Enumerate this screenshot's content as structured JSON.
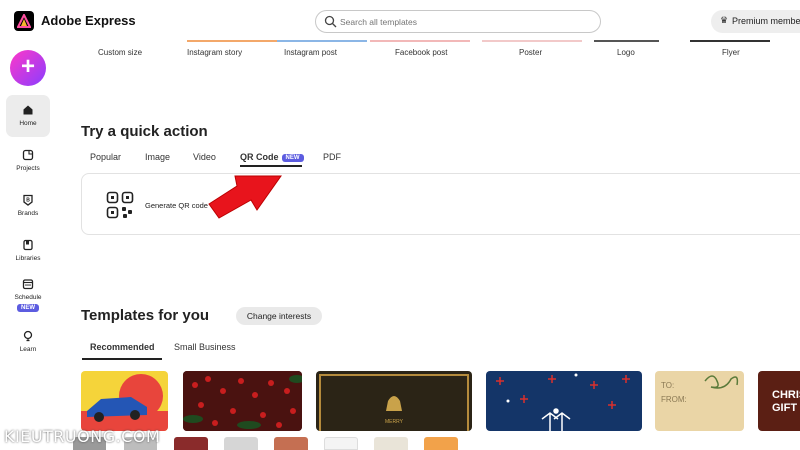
{
  "app": {
    "title": "Adobe Express"
  },
  "search": {
    "placeholder": "Search all templates"
  },
  "premium": {
    "label": "Premium member"
  },
  "sidebar": {
    "create_label": "+",
    "items": [
      {
        "label": "Home"
      },
      {
        "label": "Projects"
      },
      {
        "label": "Brands"
      },
      {
        "label": "Libraries"
      },
      {
        "label": "Schedule",
        "badge": "NEW"
      },
      {
        "label": "Learn"
      }
    ]
  },
  "template_sizes": [
    "Custom size",
    "Instagram story",
    "Instagram post",
    "Facebook post",
    "Poster",
    "Logo",
    "Flyer"
  ],
  "quick_action": {
    "title": "Try a quick action",
    "tabs": [
      "Popular",
      "Image",
      "Video",
      "QR Code",
      "PDF"
    ],
    "active_tab_badge": "NEW",
    "item_label": "Generate QR code"
  },
  "templates": {
    "title": "Templates for you",
    "change_interests": "Change interests",
    "tabs": [
      "Recommended",
      "Small Business"
    ]
  },
  "thumbnail_text": {
    "merry": "MERRY",
    "to": "TO:",
    "from": "FROM:",
    "christmas_gift": "CHRIS\nGIFT"
  },
  "watermark": "KIEUTRUONG.COM",
  "colors": {
    "accent_purple": "#5c5ce0",
    "arrow_red": "#e8141c"
  }
}
